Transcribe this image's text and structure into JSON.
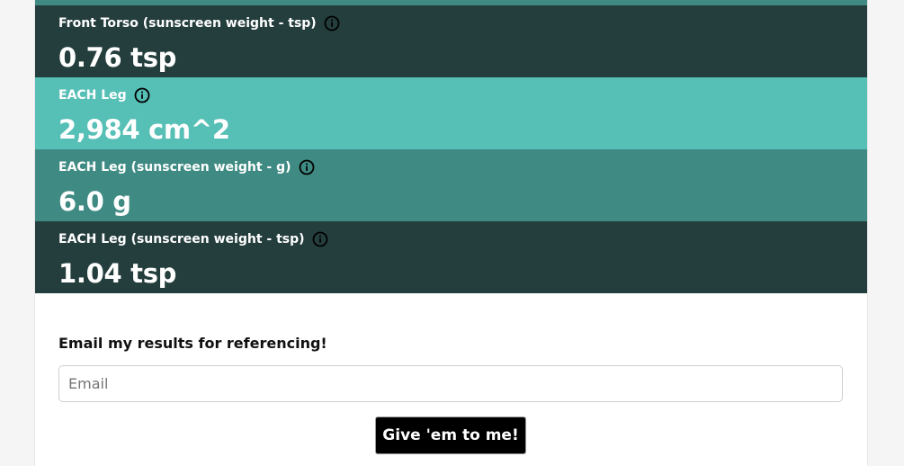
{
  "colors": {
    "dark_teal": "#243e3d",
    "light_teal": "#56bfb6",
    "mid_teal": "#3f8b84",
    "button_bg": "#000000"
  },
  "results": [
    {
      "label": "Front Torso (sunscreen weight - tsp)",
      "value": "0.76 tsp",
      "icon": "info-icon"
    },
    {
      "label": "EACH Leg",
      "value": "2,984 cm^2",
      "icon": "info-icon"
    },
    {
      "label": "EACH Leg (sunscreen weight - g)",
      "value": "6.0 g",
      "icon": "info-icon"
    },
    {
      "label": "EACH Leg (sunscreen weight - tsp)",
      "value": "1.04 tsp",
      "icon": "info-icon"
    }
  ],
  "email": {
    "heading": "Email my results for referencing!",
    "placeholder": "Email",
    "value": "",
    "button_label": "Give 'em to me!"
  }
}
